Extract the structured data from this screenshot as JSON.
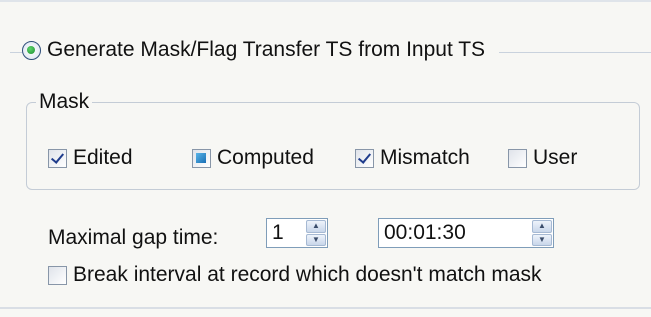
{
  "mode_radio": {
    "label": "Generate Mask/Flag Transfer TS from Input TS",
    "selected": true
  },
  "mask_group": {
    "title": "Mask",
    "options": [
      {
        "label": "Edited",
        "state": "checked"
      },
      {
        "label": "Computed",
        "state": "indeterminate"
      },
      {
        "label": "Mismatch",
        "state": "checked"
      },
      {
        "label": "User",
        "state": "unchecked"
      }
    ]
  },
  "gap": {
    "label": "Maximal gap time:",
    "count": "1",
    "time": "00:01:30"
  },
  "break_option": {
    "label": "Break interval at record which doesn't match mask",
    "state": "unchecked"
  },
  "icons": {
    "spin_up": "spin-up-icon",
    "spin_down": "spin-down-icon"
  }
}
